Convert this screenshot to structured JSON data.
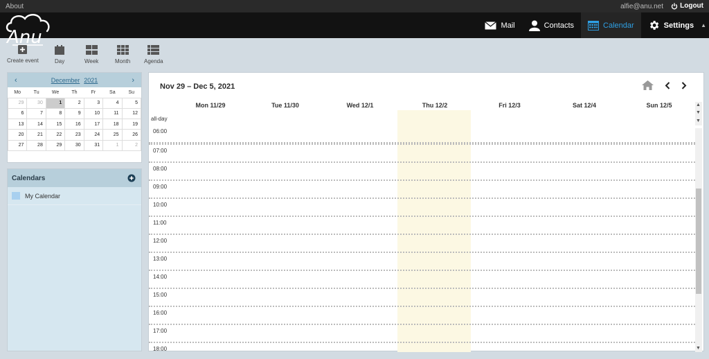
{
  "topbar": {
    "about": "About",
    "user": "alfie@anu.net",
    "logout": "Logout"
  },
  "nav": {
    "items": [
      {
        "label": "Mail",
        "icon": "mail-icon"
      },
      {
        "label": "Contacts",
        "icon": "contacts-icon"
      },
      {
        "label": "Calendar",
        "icon": "calendar-icon",
        "active": true
      },
      {
        "label": "Settings",
        "icon": "gear-icon"
      }
    ],
    "active_color": "#2e9fe3"
  },
  "toolbar": {
    "create": "Create event",
    "day": "Day",
    "week": "Week",
    "month": "Month",
    "agenda": "Agenda"
  },
  "minical": {
    "month": "December",
    "year": "2021",
    "weekdays": [
      "Mo",
      "Tu",
      "We",
      "Th",
      "Fr",
      "Sa",
      "Su"
    ],
    "weeks": [
      [
        "29",
        "30",
        "1",
        "2",
        "3",
        "4",
        "5"
      ],
      [
        "6",
        "7",
        "8",
        "9",
        "10",
        "11",
        "12"
      ],
      [
        "13",
        "14",
        "15",
        "16",
        "17",
        "18",
        "19"
      ],
      [
        "20",
        "21",
        "22",
        "23",
        "24",
        "25",
        "26"
      ],
      [
        "27",
        "28",
        "29",
        "30",
        "31",
        "1",
        "2"
      ]
    ]
  },
  "calendars": {
    "title": "Calendars",
    "items": [
      {
        "label": "My Calendar",
        "color": "#a8d0ef"
      }
    ]
  },
  "main": {
    "range": "Nov 29 – Dec 5, 2021",
    "days": [
      "Mon 11/29",
      "Tue 11/30",
      "Wed 12/1",
      "Thu 12/2",
      "Fri 12/3",
      "Sat 12/4",
      "Sun 12/5"
    ],
    "allday": "all-day",
    "hours": [
      "06:00",
      "07:00",
      "08:00",
      "09:00",
      "10:00",
      "11:00",
      "12:00",
      "13:00",
      "14:00",
      "15:00",
      "16:00",
      "17:00",
      "18:00"
    ],
    "today_color": "#fcf8e3"
  }
}
